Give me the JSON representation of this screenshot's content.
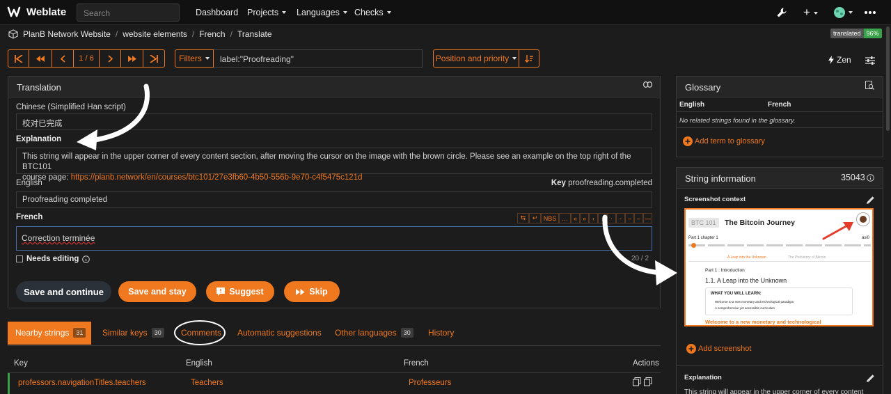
{
  "nav": {
    "brand": "Weblate",
    "search_placeholder": "Search",
    "links": [
      "Dashboard",
      "Projects",
      "Languages",
      "Checks"
    ],
    "plus_label": "+"
  },
  "breadcrumb": [
    "PlanB Network Website",
    "website elements",
    "French",
    "Translate"
  ],
  "badge": {
    "label": "translated",
    "value": "96%"
  },
  "pager": {
    "position": "1 / 6"
  },
  "filter": {
    "button": "Filters",
    "query": "label:\"Proofreading\""
  },
  "sort": {
    "button": "Position and priority"
  },
  "zen": "Zen",
  "translation": {
    "title": "Translation",
    "source_lang": "Chinese (Simplified Han script)",
    "source_text": "校对已完成",
    "explanation_label": "Explanation",
    "explanation_text": "This string will appear in the upper corner of every content section, after moving the cursor on the image with the brown circle. Please see an example on the top right of the BTC101",
    "explanation_text2": "course page: ",
    "explanation_link": "https://planb.network/en/courses/btc101/27e3fb60-4b50-556b-9e70-c4f5475c121d",
    "english_label": "English",
    "key_label": "Key",
    "key_value": "proofreading.completed",
    "english_text": "Proofreading completed",
    "french_label": "French",
    "french_text": "Correction terminée",
    "needs_editing": "Needs editing",
    "char_count": "20 / 2",
    "toolbar": [
      "NBS"
    ]
  },
  "actions": {
    "save_continue": "Save and continue",
    "save_stay": "Save and stay",
    "suggest": "Suggest",
    "skip": "Skip"
  },
  "tabs": [
    {
      "label": "Nearby strings",
      "count": "31"
    },
    {
      "label": "Similar keys",
      "count": "30"
    },
    {
      "label": "Comments"
    },
    {
      "label": "Automatic suggestions"
    },
    {
      "label": "Other languages",
      "count": "30"
    },
    {
      "label": "History"
    }
  ],
  "table": {
    "headers": [
      "Key",
      "English",
      "French",
      "Actions"
    ],
    "rows": [
      {
        "key": "professors.navigationTitles.teachers",
        "english": "Teachers",
        "french": "Professeurs"
      }
    ]
  },
  "glossary": {
    "title": "Glossary",
    "col_english": "English",
    "col_french": "French",
    "empty": "No related strings found in the glossary.",
    "add": "Add term to glossary"
  },
  "info": {
    "title": "String information",
    "id": "35043",
    "screenshot_label": "Screenshot context",
    "add_screenshot": "Add screenshot",
    "explanation_label": "Explanation",
    "explanation_preview": "This string will appear in the upper corner of every content"
  },
  "screenshot": {
    "badge": "BTC 101",
    "title": "The Bitcoin Journey",
    "part": "Part 1  chapter 1",
    "right": "asi0",
    "crumb1": "A Leap into the Unknown",
    "crumb2": "The Prehistory of Bitcoin",
    "section": "Part 1 : Introduction",
    "heading": "1.1. A Leap into the Unknown",
    "learn": "WHAT YOU WILL LEARN:",
    "item1": "Welcome to a new monetary and technological paradigm",
    "item2": "A comprehensive yet accessible curriculum",
    "footer": "Welcome to a new monetary and technological"
  },
  "colors": {
    "accent": "#f0781e",
    "success": "#3aa14b",
    "background": "#1c1c1c"
  }
}
